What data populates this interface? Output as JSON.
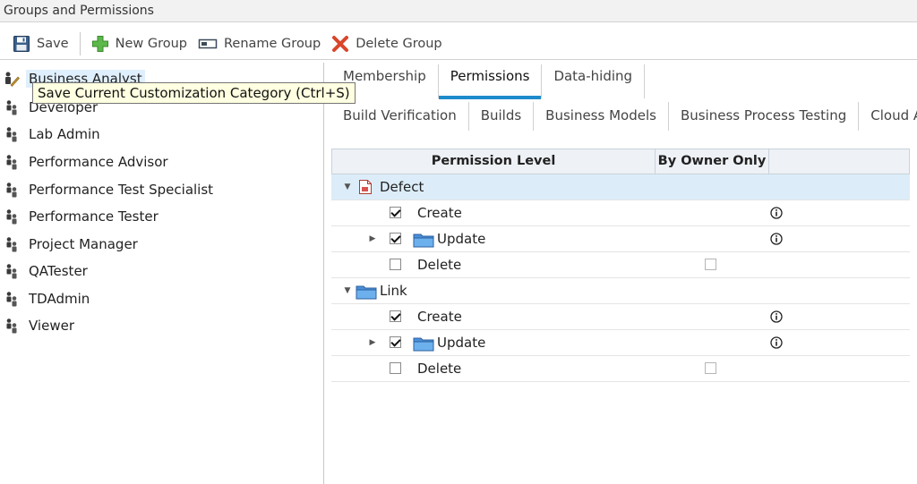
{
  "window": {
    "title": "Groups and Permissions"
  },
  "toolbar": {
    "save_label": "Save",
    "new_group_label": "New Group",
    "rename_group_label": "Rename Group",
    "delete_group_label": "Delete Group"
  },
  "tooltip": {
    "text": "Save Current Customization Category (Ctrl+S)"
  },
  "groups": [
    {
      "label": "Business Analyst"
    },
    {
      "label": "Developer"
    },
    {
      "label": "Lab Admin"
    },
    {
      "label": "Performance Advisor"
    },
    {
      "label": "Performance Test Specialist"
    },
    {
      "label": "Performance Tester"
    },
    {
      "label": "Project Manager"
    },
    {
      "label": "QATester"
    },
    {
      "label": "TDAdmin"
    },
    {
      "label": "Viewer"
    }
  ],
  "tabs": [
    {
      "label": "Membership"
    },
    {
      "label": "Permissions",
      "active": true
    },
    {
      "label": "Data-hiding"
    }
  ],
  "subtabs": [
    {
      "label": "Build Verification"
    },
    {
      "label": "Builds"
    },
    {
      "label": "Business Models"
    },
    {
      "label": "Business Process Testing"
    },
    {
      "label": "Cloud Acco"
    }
  ],
  "grid": {
    "col_permission_level": "Permission Level",
    "col_by_owner_only": "By Owner Only",
    "defect": {
      "label": "Defect",
      "create": {
        "label": "Create",
        "checked": true
      },
      "update": {
        "label": "Update",
        "checked": true
      },
      "delete": {
        "label": "Delete",
        "checked": false,
        "owner_only": false
      }
    },
    "link": {
      "label": "Link",
      "create": {
        "label": "Create",
        "checked": true
      },
      "update": {
        "label": "Update",
        "checked": true
      },
      "delete": {
        "label": "Delete",
        "checked": false,
        "owner_only": false
      }
    }
  },
  "colors": {
    "accent": "#1e8bcb",
    "selected_row": "#dcedf9",
    "tooltip_bg": "#ffffe1"
  }
}
